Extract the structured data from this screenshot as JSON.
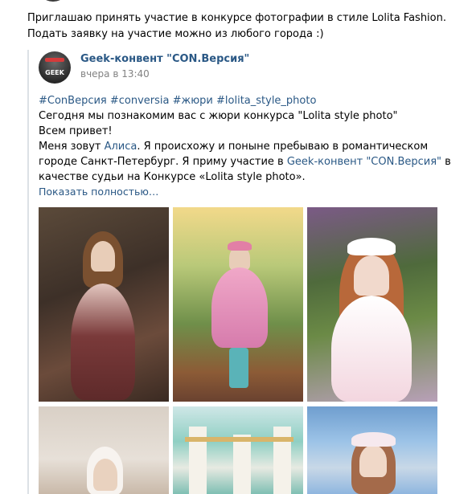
{
  "intro_text": "Приглашаю принять участие в конкурсе фотографии в стиле Lolita Fashion. Подать заявку на участие можно из любого города :)",
  "repost": {
    "avatar_text": "GEEK",
    "author": "Geek-конвент \"CON.Версия\"",
    "time": "вчера в 13:40",
    "hashtags": "#СonВерсия #conversia #жюри #lolita_style_photo",
    "line1": "Сегодня мы познакомим вас с жюри конкурса \"Lolita style photo\"",
    "line2": "Всем привет!",
    "line3_a": "Меня зовут ",
    "line3_link": "Алиса",
    "line3_b": ". Я происхожу и поныне пребываю в романтическом городе Санкт-Петербург. Я приму участие в ",
    "line3_link2": "Geek-конвент \"CON.Версия\"",
    "line3_c": " в качестве судьи на Конкурсе «Lolita style photo».",
    "show_more": "Показать полностью…"
  }
}
